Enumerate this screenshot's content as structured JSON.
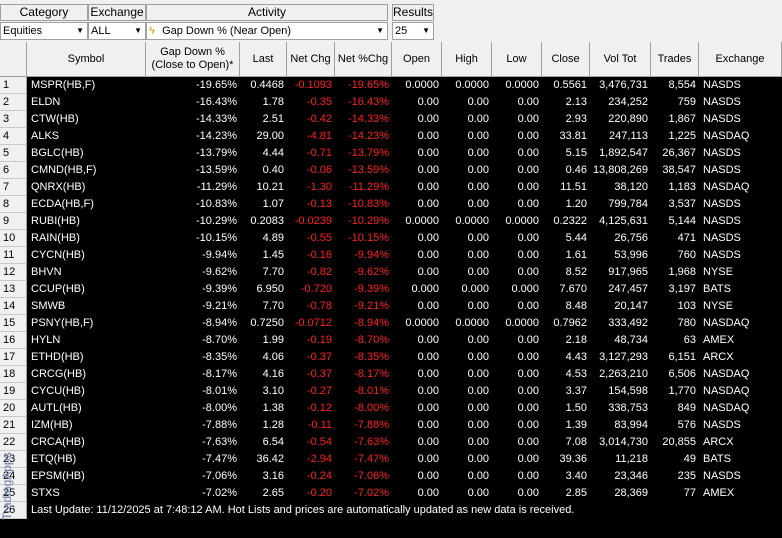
{
  "filters": {
    "category": {
      "label": "Category",
      "value": "Equities"
    },
    "exchange": {
      "label": "Exchange",
      "value": "ALL"
    },
    "activity": {
      "label": "Activity",
      "value": "Gap Down % (Near Open)"
    },
    "results": {
      "label": "Results",
      "value": "25"
    }
  },
  "columns": [
    "Symbol",
    "Gap Down %\n(Close to Open)*",
    "Last",
    "Net Chg",
    "Net %Chg",
    "Open",
    "High",
    "Low",
    "Close",
    "Vol Tot",
    "Trades",
    "Exchange"
  ],
  "rows": [
    [
      "1",
      "MSPR(HB,F)",
      "-19.65%",
      "0.4468",
      "-0.1093",
      "-19.65%",
      "0.0000",
      "0.0000",
      "0.0000",
      "0.5561",
      "3,476,731",
      "8,554",
      "NASDS"
    ],
    [
      "2",
      "ELDN",
      "-16.43%",
      "1.78",
      "-0.35",
      "-16.43%",
      "0.00",
      "0.00",
      "0.00",
      "2.13",
      "234,252",
      "759",
      "NASDS"
    ],
    [
      "3",
      "CTW(HB)",
      "-14.33%",
      "2.51",
      "-0.42",
      "-14.33%",
      "0.00",
      "0.00",
      "0.00",
      "2.93",
      "220,890",
      "1,867",
      "NASDS"
    ],
    [
      "4",
      "ALKS",
      "-14.23%",
      "29.00",
      "-4.81",
      "-14.23%",
      "0.00",
      "0.00",
      "0.00",
      "33.81",
      "247,113",
      "1,225",
      "NASDAQ"
    ],
    [
      "5",
      "BGLC(HB)",
      "-13.79%",
      "4.44",
      "-0.71",
      "-13.79%",
      "0.00",
      "0.00",
      "0.00",
      "5.15",
      "1,892,547",
      "26,367",
      "NASDS"
    ],
    [
      "6",
      "CMND(HB,F)",
      "-13.59%",
      "0.40",
      "-0.06",
      "-13.59%",
      "0.00",
      "0.00",
      "0.00",
      "0.46",
      "13,808,269",
      "38,547",
      "NASDS"
    ],
    [
      "7",
      "QNRX(HB)",
      "-11.29%",
      "10.21",
      "-1.30",
      "-11.29%",
      "0.00",
      "0.00",
      "0.00",
      "11.51",
      "38,120",
      "1,183",
      "NASDAQ"
    ],
    [
      "8",
      "ECDA(HB,F)",
      "-10.83%",
      "1.07",
      "-0.13",
      "-10.83%",
      "0.00",
      "0.00",
      "0.00",
      "1.20",
      "799,784",
      "3,537",
      "NASDS"
    ],
    [
      "9",
      "RUBI(HB)",
      "-10.29%",
      "0.2083",
      "-0.0239",
      "-10.29%",
      "0.0000",
      "0.0000",
      "0.0000",
      "0.2322",
      "4,125,631",
      "5,144",
      "NASDS"
    ],
    [
      "10",
      "RAIN(HB)",
      "-10.15%",
      "4.89",
      "-0.55",
      "-10.15%",
      "0.00",
      "0.00",
      "0.00",
      "5.44",
      "26,756",
      "471",
      "NASDS"
    ],
    [
      "11",
      "CYCN(HB)",
      "-9.94%",
      "1.45",
      "-0.16",
      "-9.94%",
      "0.00",
      "0.00",
      "0.00",
      "1.61",
      "53,996",
      "760",
      "NASDS"
    ],
    [
      "12",
      "BHVN",
      "-9.62%",
      "7.70",
      "-0.82",
      "-9.62%",
      "0.00",
      "0.00",
      "0.00",
      "8.52",
      "917,965",
      "1,968",
      "NYSE"
    ],
    [
      "13",
      "CCUP(HB)",
      "-9.39%",
      "6.950",
      "-0.720",
      "-9.39%",
      "0.000",
      "0.000",
      "0.000",
      "7.670",
      "247,457",
      "3,197",
      "BATS"
    ],
    [
      "14",
      "SMWB",
      "-9.21%",
      "7.70",
      "-0.78",
      "-9.21%",
      "0.00",
      "0.00",
      "0.00",
      "8.48",
      "20,147",
      "103",
      "NYSE"
    ],
    [
      "15",
      "PSNY(HB,F)",
      "-8.94%",
      "0.7250",
      "-0.0712",
      "-8.94%",
      "0.0000",
      "0.0000",
      "0.0000",
      "0.7962",
      "333,492",
      "780",
      "NASDAQ"
    ],
    [
      "16",
      "HYLN",
      "-8.70%",
      "1.99",
      "-0.19",
      "-8.70%",
      "0.00",
      "0.00",
      "0.00",
      "2.18",
      "48,734",
      "63",
      "AMEX"
    ],
    [
      "17",
      "ETHD(HB)",
      "-8.35%",
      "4.06",
      "-0.37",
      "-8.35%",
      "0.00",
      "0.00",
      "0.00",
      "4.43",
      "3,127,293",
      "6,151",
      "ARCX"
    ],
    [
      "18",
      "CRCG(HB)",
      "-8.17%",
      "4.16",
      "-0.37",
      "-8.17%",
      "0.00",
      "0.00",
      "0.00",
      "4.53",
      "2,263,210",
      "6,506",
      "NASDAQ"
    ],
    [
      "19",
      "CYCU(HB)",
      "-8.01%",
      "3.10",
      "-0.27",
      "-8.01%",
      "0.00",
      "0.00",
      "0.00",
      "3.37",
      "154,598",
      "1,770",
      "NASDAQ"
    ],
    [
      "20",
      "AUTL(HB)",
      "-8.00%",
      "1.38",
      "-0.12",
      "-8.00%",
      "0.00",
      "0.00",
      "0.00",
      "1.50",
      "338,753",
      "849",
      "NASDAQ"
    ],
    [
      "21",
      "IZM(HB)",
      "-7.88%",
      "1.28",
      "-0.11",
      "-7.88%",
      "0.00",
      "0.00",
      "0.00",
      "1.39",
      "83,994",
      "576",
      "NASDS"
    ],
    [
      "22",
      "CRCA(HB)",
      "-7.63%",
      "6.54",
      "-0.54",
      "-7.63%",
      "0.00",
      "0.00",
      "0.00",
      "7.08",
      "3,014,730",
      "20,855",
      "ARCX"
    ],
    [
      "23",
      "ETQ(HB)",
      "-7.47%",
      "36.42",
      "-2.94",
      "-7.47%",
      "0.00",
      "0.00",
      "0.00",
      "39.36",
      "11,218",
      "49",
      "BATS"
    ],
    [
      "24",
      "EPSM(HB)",
      "-7.06%",
      "3.16",
      "-0.24",
      "-7.06%",
      "0.00",
      "0.00",
      "0.00",
      "3.40",
      "23,346",
      "235",
      "NASDS"
    ],
    [
      "25",
      "STXS",
      "-7.02%",
      "2.65",
      "-0.20",
      "-7.02%",
      "0.00",
      "0.00",
      "0.00",
      "2.85",
      "28,369",
      "77",
      "AMEX"
    ]
  ],
  "status_row": {
    "number": "26",
    "text": "Last Update: 11/12/2025 at 7:48:12 AM.  Hot Lists and prices are automatically updated as new data is received."
  },
  "watermark": "TradingApps",
  "colors": {
    "negative": "#ff2020",
    "text": "#ffffff",
    "background": "#000000",
    "header": "#f0f0f0"
  }
}
